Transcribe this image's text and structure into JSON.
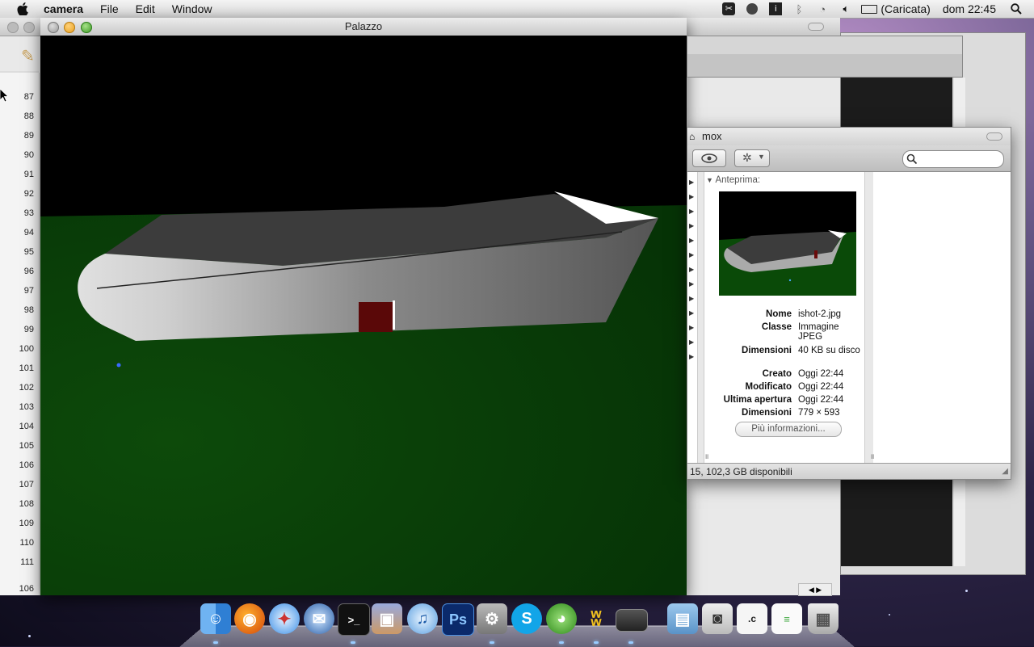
{
  "menubar": {
    "app_name": "camera",
    "menus": [
      "File",
      "Edit",
      "Window"
    ],
    "battery_status": "(Caricata)",
    "clock": "dom 22:45"
  },
  "editor": {
    "line_numbers": [
      "87",
      "88",
      "89",
      "90",
      "91",
      "92",
      "93",
      "94",
      "95",
      "96",
      "97",
      "98",
      "99",
      "100",
      "101",
      "102",
      "103",
      "104",
      "105",
      "106",
      "107",
      "108",
      "109",
      "110",
      "111"
    ],
    "current_line": "106"
  },
  "palazzo": {
    "title": "Palazzo"
  },
  "finder": {
    "title": "mox",
    "preview_header": "Anteprima:",
    "info": [
      {
        "k": "Nome",
        "v": "ishot-2.jpg"
      },
      {
        "k": "Classe",
        "v": "Immagine JPEG"
      },
      {
        "k": "Dimensioni",
        "v": "40 KB su disco"
      },
      {
        "k": "Creato",
        "v": "Oggi 22:44"
      },
      {
        "k": "Modificato",
        "v": "Oggi 22:44"
      },
      {
        "k": "Ultima apertura",
        "v": "Oggi 22:44"
      },
      {
        "k": "Dimensioni",
        "v": "779 × 593"
      }
    ],
    "more_button": "Più informazioni...",
    "status": "15, 102,3 GB disponibili"
  },
  "dock": {
    "items": [
      "finder-icon",
      "firefox-icon",
      "safari-icon",
      "mail-icon",
      "terminal-icon",
      "preview-icon",
      "itunes-icon",
      "photoshop-icon",
      "system-preferences-icon",
      "skype-icon",
      "adium-icon",
      "dashboard-icon",
      "app-window-icon",
      "documents-folder-icon",
      "camera-app-icon",
      "c-file-icon",
      "text-file-icon",
      "trash-icon"
    ],
    "photoshop_label": "Ps"
  },
  "colors": {
    "sky": "#000000",
    "ground": "#0a3c06",
    "building_top": "#3a3a3a",
    "door": "#5a0808"
  }
}
